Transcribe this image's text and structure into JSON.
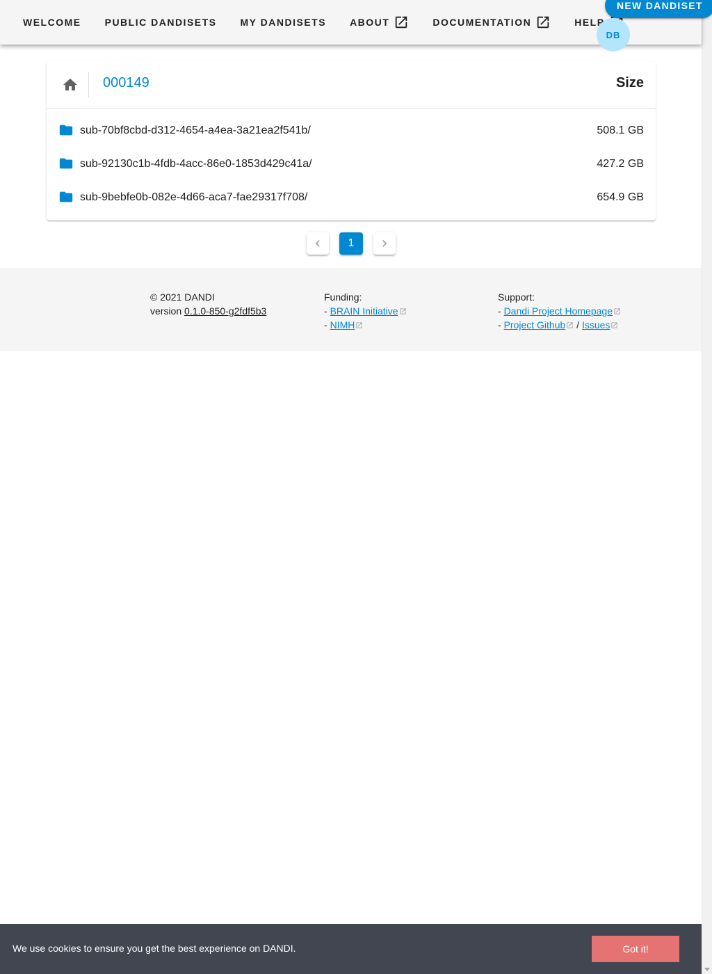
{
  "nav": {
    "items": [
      {
        "label": "Welcome",
        "external": false
      },
      {
        "label": "Public Dandisets",
        "external": false
      },
      {
        "label": "My Dandisets",
        "external": false
      },
      {
        "label": "About",
        "external": true
      },
      {
        "label": "Documentation",
        "external": true
      },
      {
        "label": "Help",
        "external": true
      }
    ],
    "new_button": "New Dandiset",
    "avatar_initials": "DB"
  },
  "browser": {
    "breadcrumb": "000149",
    "size_header": "Size",
    "rows": [
      {
        "name": "sub-70bf8cbd-d312-4654-a4ea-3a21ea2f541b/",
        "size": "508.1 GB",
        "icon": "folder-icon"
      },
      {
        "name": "sub-92130c1b-4fdb-4acc-86e0-1853d429c41a/",
        "size": "427.2 GB",
        "icon": "folder-icon"
      },
      {
        "name": "sub-9bebfe0b-082e-4d66-aca7-fae29317f708/",
        "size": "654.9 GB",
        "icon": "folder-icon"
      }
    ]
  },
  "pagination": {
    "current": "1"
  },
  "footer": {
    "copyright": "© 2021 DANDI",
    "version_prefix": "version ",
    "version": "0.1.0-850-g2fdf5b3",
    "funding_title": "Funding:",
    "funding_links": [
      "BRAIN Initiative",
      "NIMH"
    ],
    "support_title": "Support:",
    "support_links": [
      "Dandi Project Homepage",
      "Project Github",
      "Issues"
    ],
    "separator": "/",
    "dash": "- "
  },
  "cookie": {
    "message": "We use cookies to ensure you get the best experience on DANDI.",
    "button": "Got it!"
  },
  "colors": {
    "accent": "#0288d1",
    "cookie_bg": "#414650",
    "cookie_button": "#e57373"
  }
}
